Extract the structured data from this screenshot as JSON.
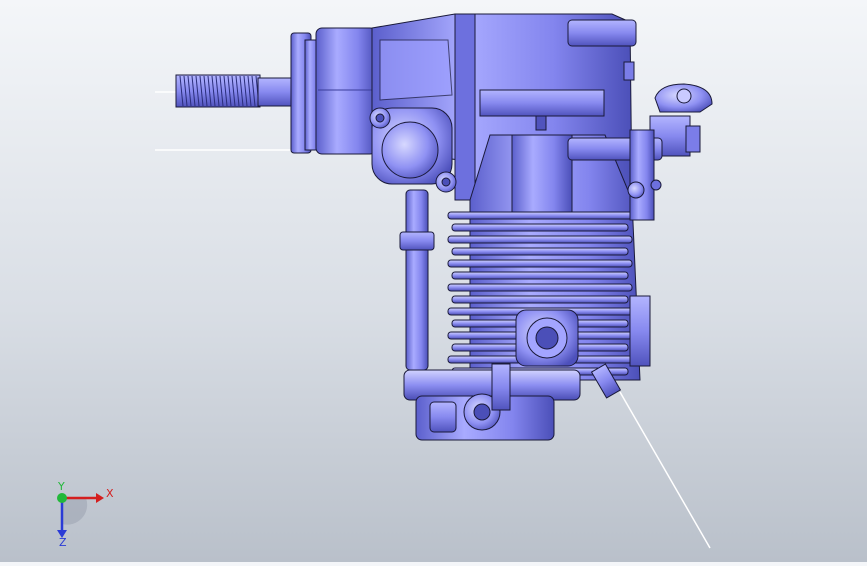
{
  "viewport": {
    "background_top": "#f4f6f9",
    "background_bottom": "#b9c0ca",
    "model_body_color": "#8a8cf0",
    "model_shadow_color": "#4b4fb8",
    "model_highlight_color": "#c9caff",
    "edge_color": "#1a1a3a"
  },
  "triad": {
    "x_label": "X",
    "y_label": "Y",
    "z_label": "Z",
    "x_color": "#d41e1e",
    "y_color": "#22b83a",
    "z_color": "#2a3bd6"
  }
}
